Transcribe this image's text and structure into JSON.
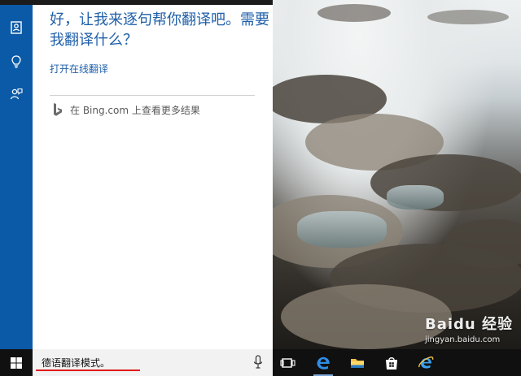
{
  "cortana": {
    "answer": "好，让我来逐句帮你翻译吧。需要我翻译什么？",
    "action_link": "打开在线翻译",
    "bing_text": "在 Bing.com 上查看更多结果"
  },
  "taskbar": {
    "search_value": "德语翻译模式。",
    "underline_color": "#e11b1b"
  },
  "watermark": {
    "brand": "Baidu 经验",
    "url": "jingyan.baidu.com"
  },
  "colors": {
    "rail_blue": "#0b5aa8",
    "accent_text": "#1f5fa9"
  },
  "icons": {
    "rail": [
      "notebook-icon",
      "lightbulb-icon",
      "feedback-icon"
    ],
    "taskbar": [
      "windows-start-icon",
      "microphone-icon",
      "task-view-icon",
      "edge-icon",
      "file-explorer-icon",
      "store-icon",
      "internet-explorer-icon"
    ]
  }
}
